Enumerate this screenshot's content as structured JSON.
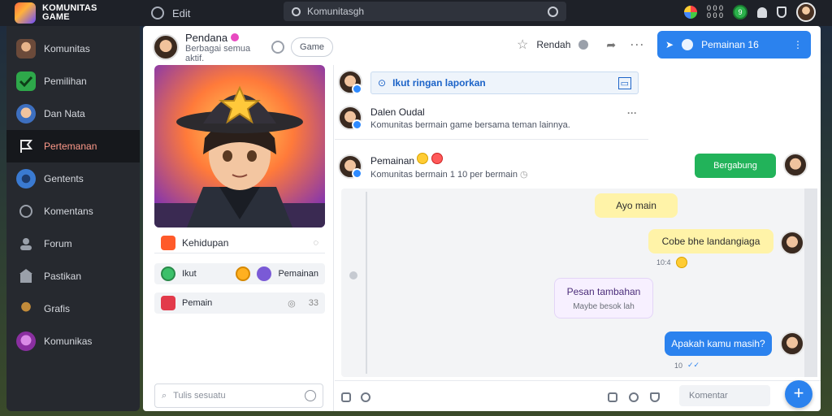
{
  "topbar": {
    "logo_line1": "KOMUNITAS",
    "logo_line2": "GAME",
    "edit_label": "Edit",
    "search_text": "Komunitasgh",
    "counts": "0 0 0\n0 0 0",
    "green_badge": "9"
  },
  "sidebar": {
    "items": [
      {
        "label": "Komunitas",
        "icon": "warrior-icon",
        "color": "#6b4a3a"
      },
      {
        "label": "Pemilihan",
        "icon": "check-icon",
        "color": "#2ea84a"
      },
      {
        "label": "Dan Nata",
        "icon": "hero-icon",
        "color": "#3d6fbf"
      },
      {
        "label": "Pertemanan",
        "icon": "flag-icon",
        "color": "#e8e8e8"
      },
      {
        "label": "Gentents",
        "icon": "ninja-icon",
        "color": "#3a7ad1"
      },
      {
        "label": "Komentans",
        "icon": "chat-icon",
        "color": "#9aa0aa"
      },
      {
        "label": "Forum",
        "icon": "user-icon",
        "color": "#9aa0aa"
      },
      {
        "label": "Pastikan",
        "icon": "store-icon",
        "color": "#9aa0aa"
      },
      {
        "label": "Grafis",
        "icon": "character-icon",
        "color": "#c28b3a"
      },
      {
        "label": "Komunikas",
        "icon": "mage-icon",
        "color": "#b24fc2"
      }
    ]
  },
  "profile": {
    "name": "Pendana",
    "subtitle": "Berbagai semua aktif.",
    "game_button": "Game",
    "stats_title": "Kehidupan",
    "row1_label": "Ikut",
    "row1_extra": "Pemainan",
    "row2_label": "Pemain",
    "row2_num": "33",
    "input_placeholder": "Tulis sesuatu"
  },
  "header": {
    "label": "Rendah",
    "chip_label": "Pemainan 16"
  },
  "threads": {
    "t1_text": "Ikut ringan laporkan",
    "t2_title": "Dalen Oudal",
    "t2_sub": "Komunitas bermain game bersama teman lainnya.",
    "t3_title": "Pemainan",
    "t3_sub": "Komunitas bermain 1 10 per bermain",
    "green_button": "Bergabung"
  },
  "chat": {
    "bubble1": "Ayo main",
    "bubble2": "Cobe bhe landangiaga",
    "bubble2_meta": "10:4",
    "bubble3_title": "Pesan tambahan",
    "bubble3_sub": "Maybe besok lah",
    "bubble4": "Apakah kamu masih?",
    "bubble4_meta": "10"
  },
  "bottom": {
    "input_placeholder": "Komentar"
  },
  "colors": {
    "accent_blue": "#2b82ee",
    "accent_green": "#22b35a",
    "sidebar_bg": "#26292f"
  }
}
